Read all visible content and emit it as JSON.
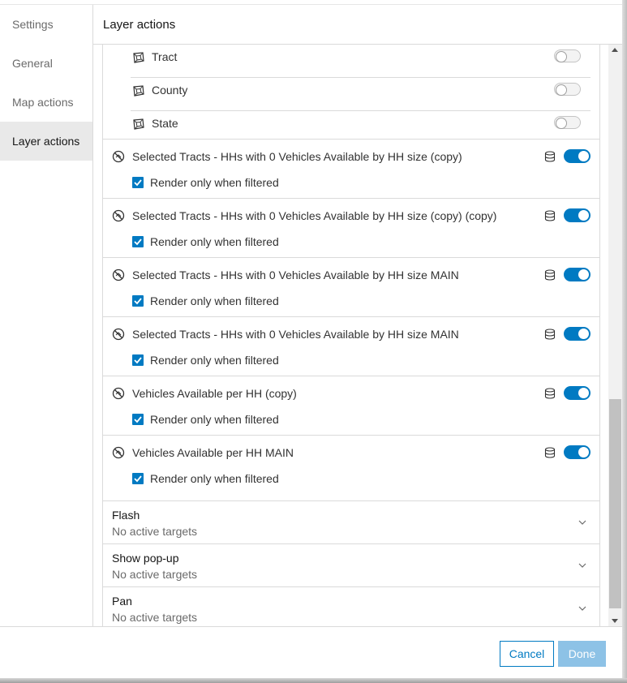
{
  "sidebar": {
    "items": [
      {
        "label": "Settings"
      },
      {
        "label": "General"
      },
      {
        "label": "Map actions"
      },
      {
        "label": "Layer actions"
      }
    ]
  },
  "header": {
    "title": "Layer actions"
  },
  "sublayers": [
    {
      "label": "Tract",
      "icon": "polygon-layer-icon",
      "enabled": false
    },
    {
      "label": "County",
      "icon": "polygon-layer-icon",
      "enabled": false
    },
    {
      "label": "State",
      "icon": "polygon-layer-icon",
      "enabled": false
    }
  ],
  "layers": [
    {
      "label": "Selected Tracts - HHs with 0 Vehicles Available by HH size (copy)",
      "enabled": true,
      "check_label": "Render only when filtered",
      "checked": true
    },
    {
      "label": "Selected Tracts - HHs with 0 Vehicles Available by HH size (copy) (copy)",
      "enabled": true,
      "check_label": "Render only when filtered",
      "checked": true
    },
    {
      "label": "Selected Tracts - HHs with 0 Vehicles Available by HH size MAIN",
      "enabled": true,
      "check_label": "Render only when filtered",
      "checked": true
    },
    {
      "label": "Selected Tracts - HHs with 0 Vehicles Available by HH size MAIN",
      "enabled": true,
      "check_label": "Render only when filtered",
      "checked": true
    },
    {
      "label": "Vehicles Available per HH (copy)",
      "enabled": true,
      "check_label": "Render only when filtered",
      "checked": true
    },
    {
      "label": "Vehicles Available per HH MAIN",
      "enabled": true,
      "check_label": "Render only when filtered",
      "checked": true
    }
  ],
  "actions": [
    {
      "title": "Flash",
      "status": "No active targets"
    },
    {
      "title": "Show pop-up",
      "status": "No active targets"
    },
    {
      "title": "Pan",
      "status": "No active targets"
    }
  ],
  "footer": {
    "cancel_label": "Cancel",
    "done_label": "Done"
  },
  "colors": {
    "accent": "#007ac2",
    "disabled_button": "#8dc2e6",
    "active_nav_bg": "#e9e9e9"
  }
}
